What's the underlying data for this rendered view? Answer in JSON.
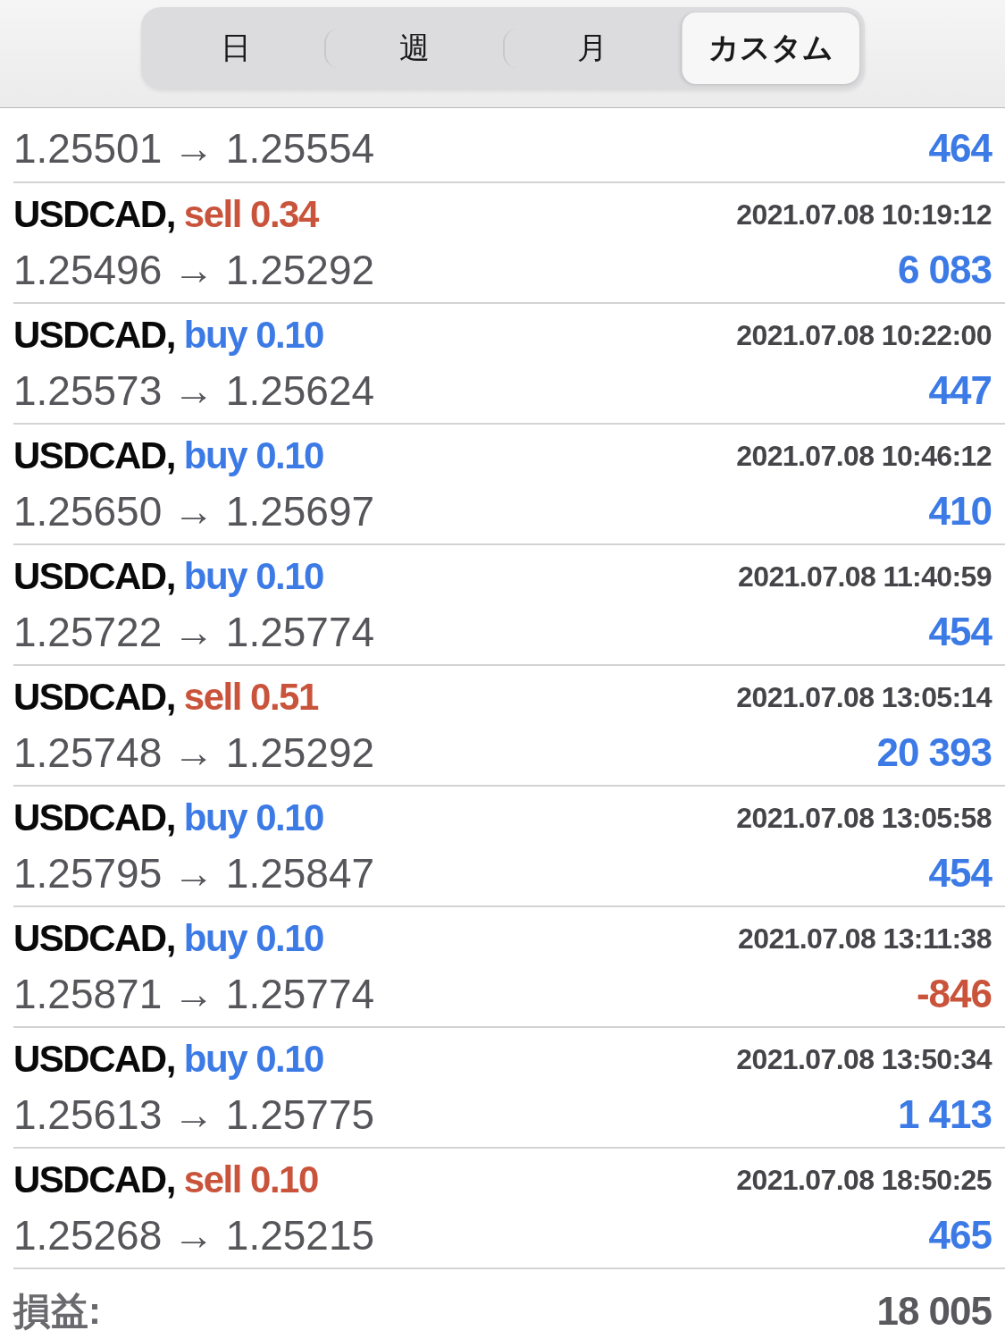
{
  "tabs": [
    {
      "label": "日",
      "selected": false
    },
    {
      "label": "週",
      "selected": false
    },
    {
      "label": "月",
      "selected": false
    },
    {
      "label": "カスタム",
      "selected": true
    }
  ],
  "trades": [
    {
      "prices": "1.25501 → 1.25554",
      "profit": "464",
      "loss": false
    },
    {
      "symbol": "USDCAD,",
      "order": "sell 0.34",
      "color": "#c9533b",
      "time": "2021.07.08 10:19:12",
      "prices": "1.25496 → 1.25292",
      "profit": "6 083",
      "loss": false
    },
    {
      "symbol": "USDCAD,",
      "order": "buy 0.10",
      "color": "#3c7ae6",
      "time": "2021.07.08 10:22:00",
      "prices": "1.25573 → 1.25624",
      "profit": "447",
      "loss": false
    },
    {
      "symbol": "USDCAD,",
      "order": "buy 0.10",
      "color": "#3c7ae6",
      "time": "2021.07.08 10:46:12",
      "prices": "1.25650 → 1.25697",
      "profit": "410",
      "loss": false
    },
    {
      "symbol": "USDCAD,",
      "order": "buy 0.10",
      "color": "#3c7ae6",
      "time": "2021.07.08 11:40:59",
      "prices": "1.25722 → 1.25774",
      "profit": "454",
      "loss": false
    },
    {
      "symbol": "USDCAD,",
      "order": "sell 0.51",
      "color": "#c9533b",
      "time": "2021.07.08 13:05:14",
      "prices": "1.25748 → 1.25292",
      "profit": "20 393",
      "loss": false
    },
    {
      "symbol": "USDCAD,",
      "order": "buy 0.10",
      "color": "#3c7ae6",
      "time": "2021.07.08 13:05:58",
      "prices": "1.25795 → 1.25847",
      "profit": "454",
      "loss": false
    },
    {
      "symbol": "USDCAD,",
      "order": "buy 0.10",
      "color": "#3c7ae6",
      "time": "2021.07.08 13:11:38",
      "prices": "1.25871 → 1.25774",
      "profit": "-846",
      "loss": true
    },
    {
      "symbol": "USDCAD,",
      "order": "buy 0.10",
      "color": "#3c7ae6",
      "time": "2021.07.08 13:50:34",
      "prices": "1.25613 → 1.25775",
      "profit": "1 413",
      "loss": false
    },
    {
      "symbol": "USDCAD,",
      "order": "sell 0.10",
      "color": "#c9533b",
      "time": "2021.07.08 18:50:25",
      "prices": "1.25268 → 1.25215",
      "profit": "465",
      "loss": false
    }
  ],
  "total": {
    "label": "損益:",
    "value": "18 005"
  }
}
